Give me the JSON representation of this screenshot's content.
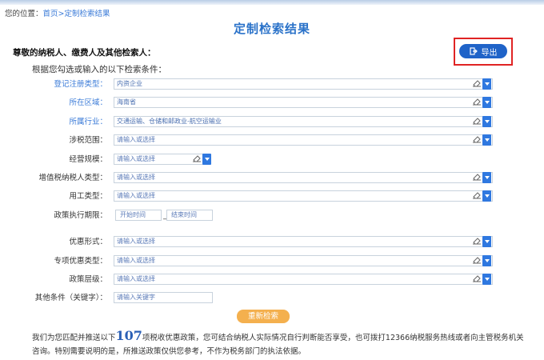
{
  "breadcrumb": {
    "prefix": "您的位置：",
    "home": "首页",
    "separator": ">",
    "current": "定制检索结果"
  },
  "page_title": "定制检索结果",
  "greeting": "尊敬的纳税人、缴费人及其他检索人：",
  "export_label": "导出",
  "intro": "根据您勾选或输入的以下检索条件：",
  "fields": {
    "registration_type": {
      "label": "登记注册类型：",
      "value": "内资企业"
    },
    "region": {
      "label": "所在区域：",
      "value": "海南省"
    },
    "industry": {
      "label": "所属行业：",
      "value": "交通运输、仓储和邮政业-航空运输业"
    },
    "tax_scope": {
      "label": "涉税范围：",
      "placeholder": "请输入或选择"
    },
    "business_scale": {
      "label": "经营规模：",
      "placeholder": "请输入或选择"
    },
    "vat_taxpayer_type": {
      "label": "增值税纳税人类型：",
      "placeholder": "请输入或选择"
    },
    "employment_type": {
      "label": "用工类型：",
      "placeholder": "请输入或选择"
    },
    "policy_period": {
      "label": "政策执行期限：",
      "start_placeholder": "开始时间",
      "separator": "_",
      "end_placeholder": "结束时间"
    },
    "preference_form": {
      "label": "优惠形式：",
      "placeholder": "请输入或选择"
    },
    "special_preference_type": {
      "label": "专项优惠类型：",
      "placeholder": "请输入或选择"
    },
    "policy_level": {
      "label": "政策层级：",
      "placeholder": "请输入或选择"
    },
    "other_conditions": {
      "label": "其他条件（关键字）：",
      "placeholder": "请输入关键字"
    }
  },
  "search_again_label": "重新检索",
  "footer": {
    "text_before": "我们为您匹配并推送以下",
    "count": "107",
    "text_after": "项税收优惠政策，您可结合纳税人实际情况自行判断能否享受，也可拨打12366纳税服务热线或者向主管税务机关咨询。特别需要说明的是，所推送政策仅供您参考，不作为税务部门的执法依据。"
  },
  "colors": {
    "accent": "#2a72c9",
    "dropdown": "#2f78e0",
    "button_primary": "#1f63c8",
    "button_search": "#f4b04e",
    "highlight_frame": "#e02424"
  },
  "icons": {
    "export": "export-icon",
    "clear": "eraser-icon",
    "dropdown": "chevron-down-icon"
  }
}
